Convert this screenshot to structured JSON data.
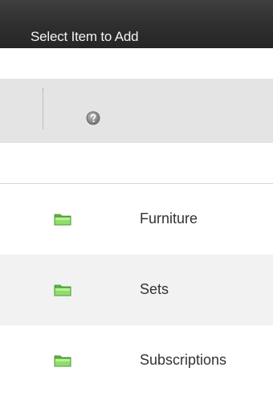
{
  "dialog": {
    "title": "Select Item to Add"
  },
  "toolbar": {
    "help_icon": "help-icon"
  },
  "items": [
    {
      "label": "Furniture",
      "icon": "folder-icon"
    },
    {
      "label": "Sets",
      "icon": "folder-icon"
    },
    {
      "label": "Subscriptions",
      "icon": "folder-icon"
    }
  ],
  "colors": {
    "titlebar": "#2e2e2e",
    "toolbar": "#e4e4e4",
    "folder": "#6cc24a",
    "row_alt": "#f2f2f2"
  }
}
